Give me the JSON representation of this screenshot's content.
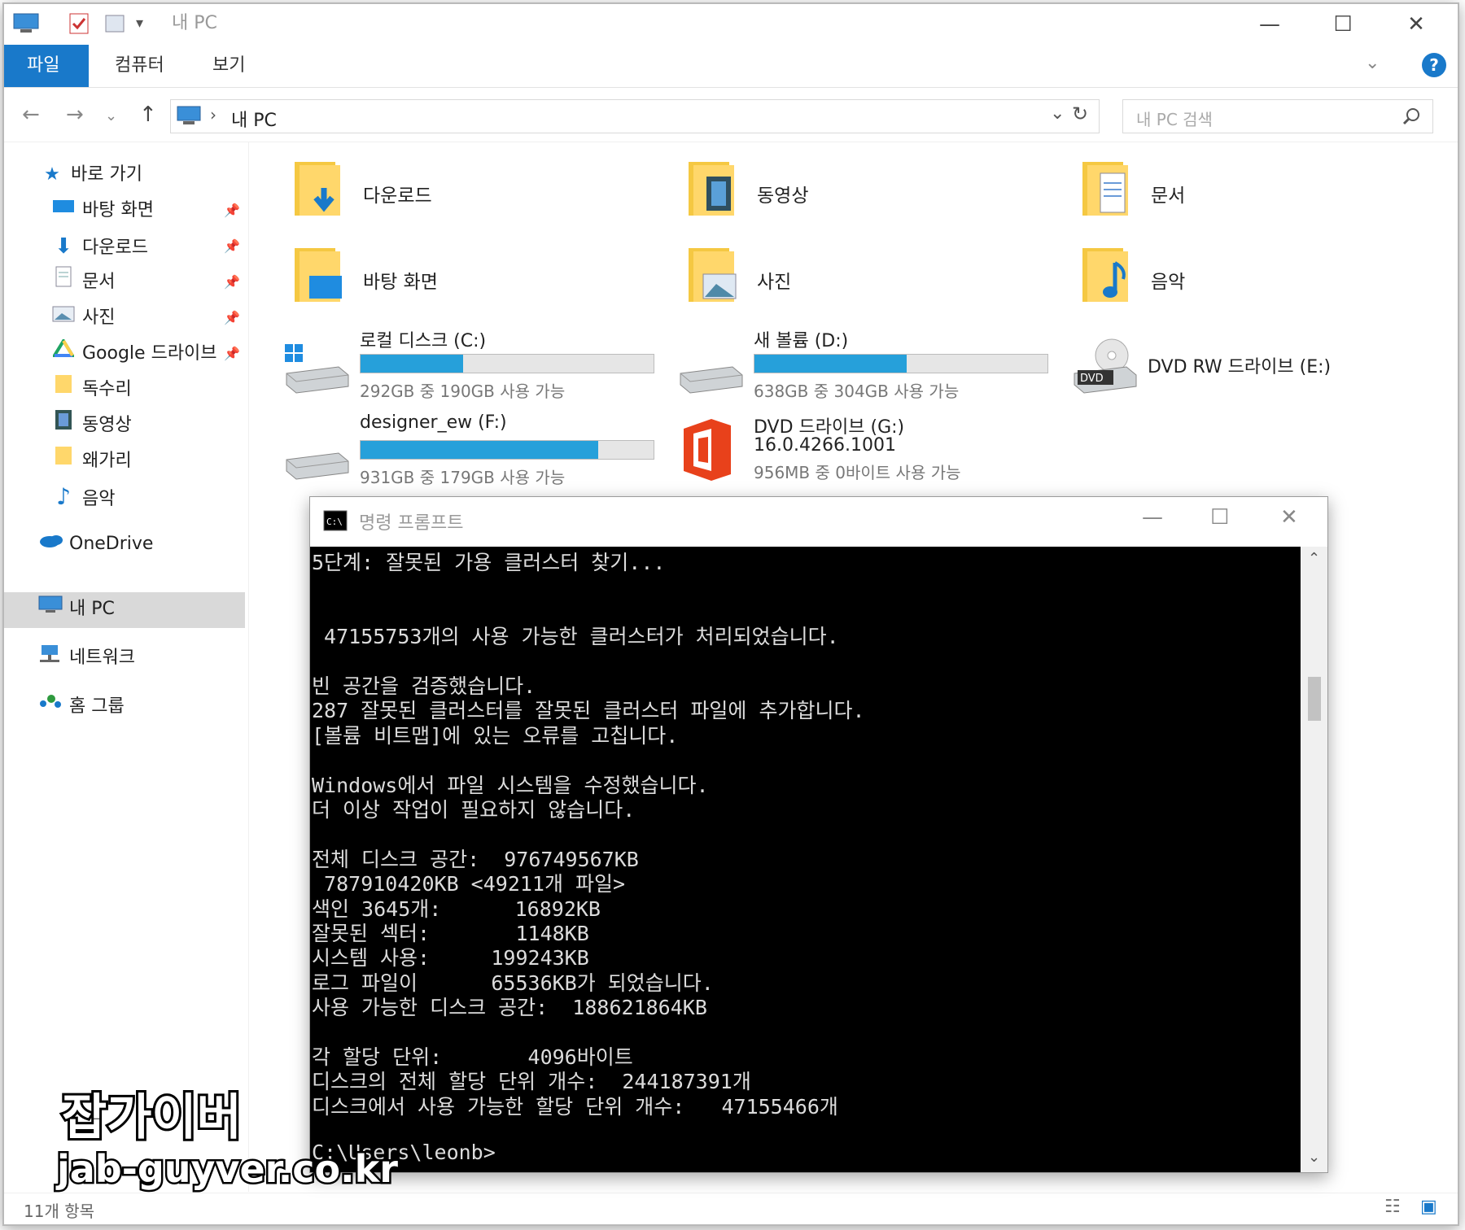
{
  "window": {
    "title": "내 PC"
  },
  "ribbon": {
    "tabs": [
      "파일",
      "컴퓨터",
      "보기"
    ]
  },
  "navigation": {
    "path_label": "내 PC",
    "search_placeholder": "내 PC 검색"
  },
  "sidebar": {
    "items": [
      {
        "label": "바로 가기",
        "icon": "star-icon",
        "pinned": false
      },
      {
        "label": "바탕 화면",
        "icon": "desktop-icon",
        "pinned": true
      },
      {
        "label": "다운로드",
        "icon": "download-icon",
        "pinned": true
      },
      {
        "label": "문서",
        "icon": "document-icon",
        "pinned": true
      },
      {
        "label": "사진",
        "icon": "picture-icon",
        "pinned": true
      },
      {
        "label": "Google 드라이브",
        "icon": "google-drive-icon",
        "pinned": true
      },
      {
        "label": "독수리",
        "icon": "folder-icon",
        "pinned": false
      },
      {
        "label": "동영상",
        "icon": "video-icon",
        "pinned": false
      },
      {
        "label": "왜가리",
        "icon": "folder-icon",
        "pinned": false
      },
      {
        "label": "음악",
        "icon": "music-icon",
        "pinned": false
      },
      {
        "label": "OneDrive",
        "icon": "onedrive-icon",
        "pinned": false
      },
      {
        "label": "내 PC",
        "icon": "pc-icon",
        "pinned": false
      },
      {
        "label": "네트워크",
        "icon": "network-icon",
        "pinned": false
      },
      {
        "label": "홈 그룹",
        "icon": "homegroup-icon",
        "pinned": false
      }
    ]
  },
  "folders": [
    {
      "name": "다운로드",
      "icon": "download-folder-icon"
    },
    {
      "name": "동영상",
      "icon": "video-folder-icon"
    },
    {
      "name": "문서",
      "icon": "document-folder-icon"
    },
    {
      "name": "바탕 화면",
      "icon": "desktop-folder-icon"
    },
    {
      "name": "사진",
      "icon": "picture-folder-icon"
    },
    {
      "name": "음악",
      "icon": "music-folder-icon"
    }
  ],
  "drives": [
    {
      "name": "로컬 디스크 (C:)",
      "space": "292GB 중 190GB 사용 가능",
      "used_fraction": 0.35
    },
    {
      "name": "새 볼륨 (D:)",
      "space": "638GB 중 304GB 사용 가능",
      "used_fraction": 0.52
    },
    {
      "name": "DVD RW 드라이브 (E:)"
    },
    {
      "name": "designer_ew (F:)",
      "space": "931GB 중 179GB 사용 가능",
      "used_fraction": 0.81
    },
    {
      "name": "DVD 드라이브 (G:)",
      "version": "16.0.4266.1001",
      "space": "956MB 중 0바이트 사용 가능"
    }
  ],
  "status": {
    "item_count": "11개 항목"
  },
  "cmd": {
    "title": "명령 프롬프트",
    "lines": [
      "5단계: 잘못된 가용 클러스터 찾기...",
      "",
      "",
      " 47155753개의 사용 가능한 클러스터가 처리되었습니다.",
      "",
      "빈 공간을 검증했습니다.",
      "287 잘못된 클러스터를 잘못된 클러스터 파일에 추가합니다.",
      "[볼륨 비트맵]에 있는 오류를 고칩니다.",
      "",
      "Windows에서 파일 시스템을 수정했습니다.",
      "더 이상 작업이 필요하지 않습니다.",
      "",
      "전체 디스크 공간:  976749567KB",
      " 787910420KB <49211개 파일>",
      "색인 3645개:      16892KB",
      "잘못된 섹터:       1148KB",
      "시스템 사용:     199243KB",
      "로그 파일이      65536KB가 되었습니다.",
      "사용 가능한 디스크 공간:  188621864KB",
      "",
      "각 할당 단위:       4096바이트",
      "디스크의 전체 할당 단위 개수:  244187391개",
      "디스크에서 사용 가능한 할당 단위 개수:   47155466개",
      "",
      "C:\\Users\\leonb>"
    ]
  },
  "watermark": {
    "title": "잡가이버",
    "url": "jab-guyver.co.kr"
  }
}
